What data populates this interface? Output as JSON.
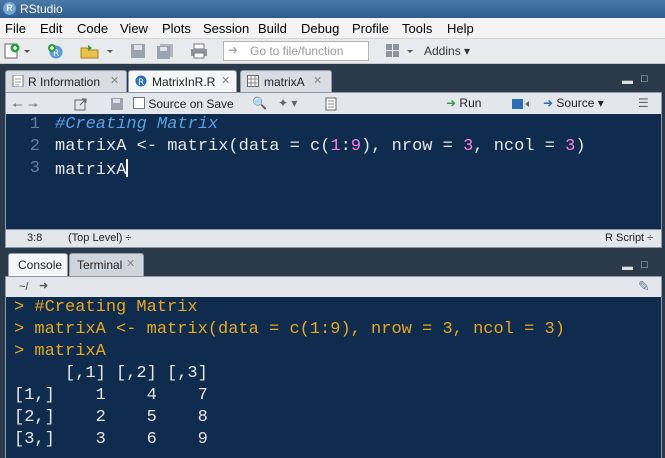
{
  "window": {
    "title": "RStudio"
  },
  "menu": [
    "File",
    "Edit",
    "Code",
    "View",
    "Plots",
    "Session",
    "Build",
    "Debug",
    "Profile",
    "Tools",
    "Help"
  ],
  "toolbar": {
    "goto_placeholder": "Go to file/function",
    "addins_label": "Addins"
  },
  "editor": {
    "tabs": [
      {
        "label": "R Information",
        "icon": "r-info-icon"
      },
      {
        "label": "MatrixInR.R",
        "icon": "r-file-icon",
        "active": true
      },
      {
        "label": "matrixA",
        "icon": "table-icon"
      }
    ],
    "source_on_save": "Source on Save",
    "run_label": "Run",
    "source_label": "Source",
    "lines": {
      "l1": {
        "n": "1",
        "comment": "#Creating Matrix"
      },
      "l2": {
        "n": "2",
        "a": "matrixA <- matrix(data = c(",
        "b": "1",
        "c": ":",
        "d": "9",
        "e": "), nrow = ",
        "f": "3",
        "g": ", ncol = ",
        "h": "3",
        "i": ")"
      },
      "l3": {
        "n": "3",
        "code": "matrixA"
      }
    },
    "status": {
      "position": "3:8",
      "scope": "(Top Level) ÷",
      "filetype": "R Script ÷"
    }
  },
  "console": {
    "tabs": [
      "Console",
      "Terminal"
    ],
    "path": "~/",
    "lines": [
      "> #Creating Matrix",
      "> matrixA <- matrix(data = c(1:9), nrow = 3, ncol = 3)",
      "> matrixA"
    ],
    "output": [
      "     [,1] [,2] [,3]",
      "[1,]    1    4    7",
      "[2,]    2    5    8",
      "[3,]    3    6    9"
    ]
  },
  "colors": {
    "editor_bg": "#0f2b4d",
    "comment": "#5aa0e6",
    "number": "#ff80e1",
    "prompt": "#e8a81e"
  }
}
